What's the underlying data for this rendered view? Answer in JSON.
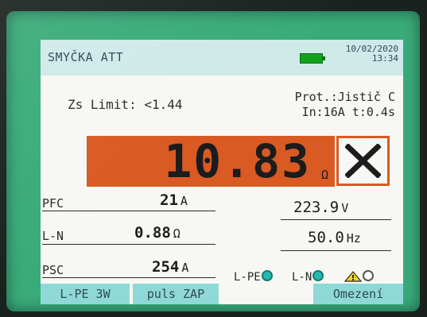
{
  "header": {
    "title": "SMYČKA ATT",
    "date": "10/02/2020",
    "time": "13:34",
    "battery_icon": "battery-full-icon"
  },
  "limit": "Zs Limit: <1.44",
  "protection": {
    "line1": "Prot.:Jistič C",
    "line2": "In:16A  t:0.4s"
  },
  "result": {
    "value": "10.83",
    "unit": "Ω",
    "status_icon": "fail-x-icon",
    "colors": {
      "fail": "#d95a23"
    }
  },
  "measurements": [
    {
      "label": "PFC",
      "value": "21",
      "unit": "A"
    },
    {
      "label": "L-N",
      "value": "0.88",
      "unit": "Ω"
    },
    {
      "label": "PSC",
      "value": "254",
      "unit": "A"
    }
  ],
  "readouts": {
    "voltage": {
      "value": "223.9",
      "unit": "V"
    },
    "frequency": {
      "value": "50.0",
      "unit": "Hz"
    }
  },
  "indicators": [
    {
      "label": "L-PE",
      "state": "on"
    },
    {
      "label": "L-N",
      "state": "on"
    },
    {
      "label": "",
      "state": "off",
      "icon": "warning-triangle-icon"
    }
  ],
  "buttons": {
    "left": "L-PE 3W",
    "middle": "puls ZAP",
    "right": "Omezení"
  }
}
